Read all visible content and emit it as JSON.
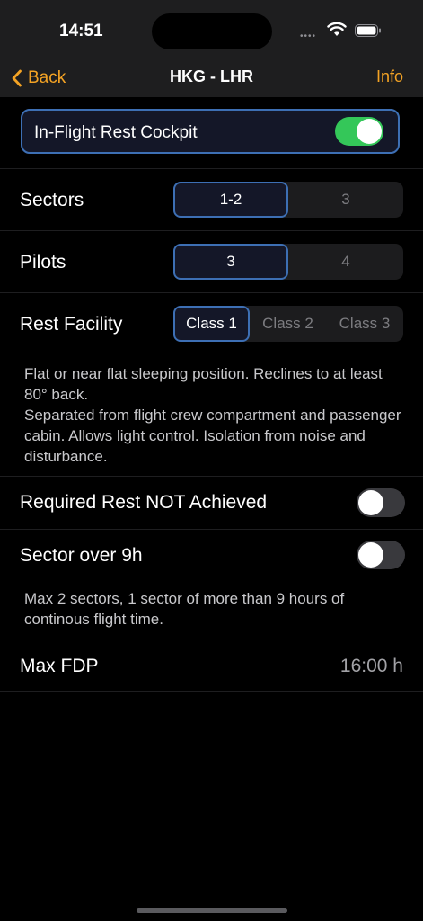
{
  "status": {
    "time": "14:51"
  },
  "nav": {
    "back_label": "Back",
    "title": "HKG - LHR",
    "info_label": "Info"
  },
  "inflight": {
    "label": "In-Flight Rest Cockpit",
    "enabled": true
  },
  "sectors": {
    "label": "Sectors",
    "options": [
      "1-2",
      "3"
    ],
    "selected": "1-2"
  },
  "pilots": {
    "label": "Pilots",
    "options": [
      "3",
      "4"
    ],
    "selected": "3"
  },
  "rest_facility": {
    "label": "Rest Facility",
    "options": [
      "Class 1",
      "Class 2",
      "Class 3"
    ],
    "selected": "Class 1",
    "description_line1": "Flat or near flat sleeping position. Reclines to at least 80° back.",
    "description_line2": "Separated from flight crew compartment and passenger cabin. Allows light control. Isolation from noise and disturbance."
  },
  "required_rest": {
    "label": "Required Rest NOT Achieved",
    "enabled": false
  },
  "sector_over": {
    "label": "Sector over 9h",
    "enabled": false,
    "description": "Max 2 sectors, 1 sector of more than 9 hours of continous flight time."
  },
  "max_fdp": {
    "label": "Max FDP",
    "value": "16:00 h"
  },
  "colors": {
    "accent": "#f4a324",
    "toggle_on": "#34c759",
    "selected_border": "#3d6fb4"
  }
}
